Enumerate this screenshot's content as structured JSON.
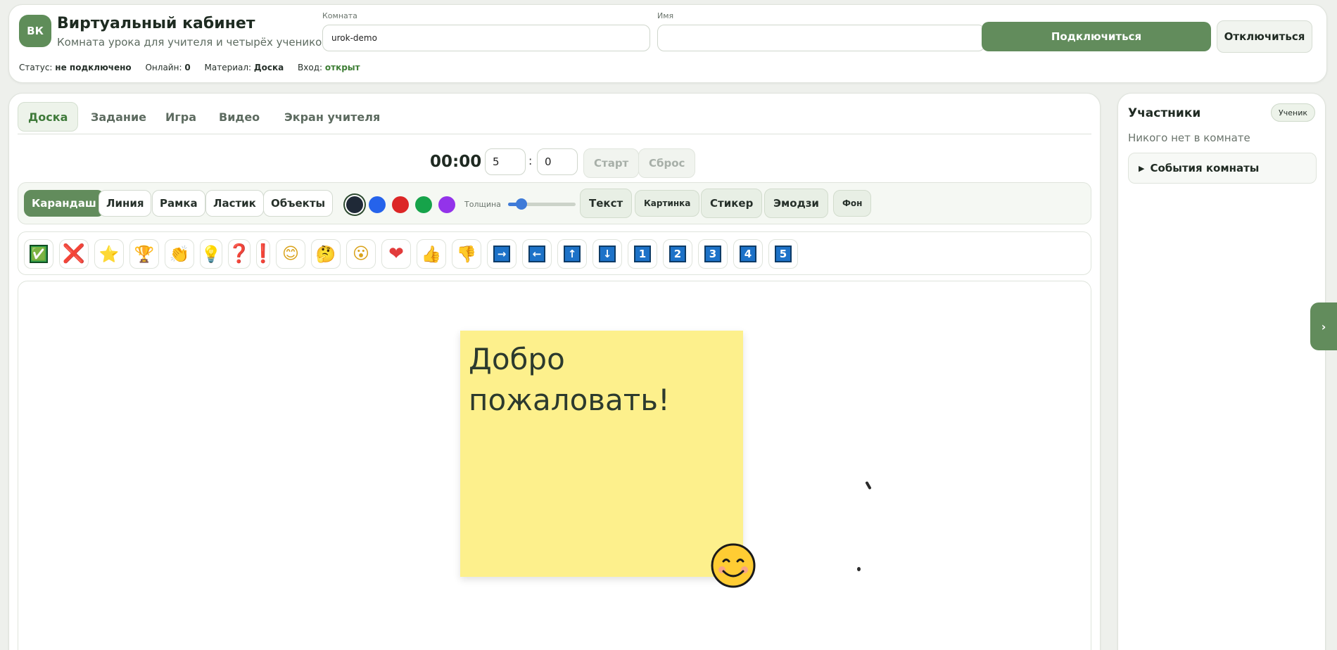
{
  "header": {
    "logo": "ВК",
    "title": "Виртуальный кабинет",
    "subtitle": "Комната урока для учителя и четырёх учеников",
    "room_label": "Комната",
    "room_value": "urok-demo",
    "name_label": "Имя",
    "name_value": "",
    "connect_label": "Подключиться",
    "disconnect_label": "Отключиться",
    "status": {
      "status_label": "Статус:",
      "status_value": "не подключено",
      "online_label": "Онлайн:",
      "online_value": "0",
      "material_label": "Материал:",
      "material_value": "Доска",
      "entry_label": "Вход:",
      "entry_value": "открыт"
    }
  },
  "tabs": [
    "Доска",
    "Задание",
    "Игра",
    "Видео",
    "Экран учителя"
  ],
  "active_tab": "Доска",
  "timer": {
    "display": "00:00",
    "minutes": "5",
    "seconds": "0",
    "separator": ":",
    "start_label": "Старт",
    "reset_label": "Сброс"
  },
  "toolbar": {
    "tools": [
      "Карандаш",
      "Линия",
      "Рамка",
      "Ластик",
      "Объекты"
    ],
    "active_tool": "Карандаш",
    "colors": [
      "#1f2937",
      "#2563eb",
      "#dc2626",
      "#16a34a",
      "#9333ea"
    ],
    "selected_color": "#1f2937",
    "thickness_label": "Толщина",
    "thickness_level": 0.2,
    "text_label": "Текст",
    "image_label": "Картинка",
    "sticker_label": "Стикер",
    "emoji_label": "Эмодзи",
    "bg_label": "Фон"
  },
  "emoji_palette": [
    {
      "name": "check-mark-icon",
      "glyph": "✅"
    },
    {
      "name": "cross-mark-icon",
      "glyph": "❌"
    },
    {
      "name": "star-icon",
      "glyph": "⭐"
    },
    {
      "name": "trophy-icon",
      "glyph": "🏆"
    },
    {
      "name": "clapping-hands-icon",
      "glyph": "👏"
    },
    {
      "name": "light-bulb-icon",
      "glyph": "💡"
    },
    {
      "name": "question-mark-icon",
      "glyph": "❓"
    },
    {
      "name": "exclamation-mark-icon",
      "glyph": "❗"
    },
    {
      "name": "smiling-face-icon",
      "glyph": "😊"
    },
    {
      "name": "thinking-face-icon",
      "glyph": "🤔"
    },
    {
      "name": "surprised-face-icon",
      "glyph": "😮"
    },
    {
      "name": "heart-icon",
      "glyph": "❤"
    },
    {
      "name": "thumbs-up-icon",
      "glyph": "👍"
    },
    {
      "name": "thumbs-down-icon",
      "glyph": "👎"
    },
    {
      "name": "arrow-right-icon",
      "glyph": "→"
    },
    {
      "name": "arrow-left-icon",
      "glyph": "←"
    },
    {
      "name": "arrow-up-icon",
      "glyph": "↑"
    },
    {
      "name": "arrow-down-icon",
      "glyph": "↓"
    },
    {
      "name": "number-1-icon",
      "glyph": "1"
    },
    {
      "name": "number-2-icon",
      "glyph": "2"
    },
    {
      "name": "number-3-icon",
      "glyph": "3"
    },
    {
      "name": "number-4-icon",
      "glyph": "4"
    },
    {
      "name": "number-5-icon",
      "glyph": "5"
    }
  ],
  "board": {
    "sticker_text": "Добро пожаловать!"
  },
  "participants": {
    "title": "Участники",
    "role": "Ученик",
    "empty_text": "Никого нет в комнате",
    "events_label": "События комнаты"
  },
  "colors": {
    "accent": "#628c5c",
    "sticker": "#fdf08c"
  }
}
